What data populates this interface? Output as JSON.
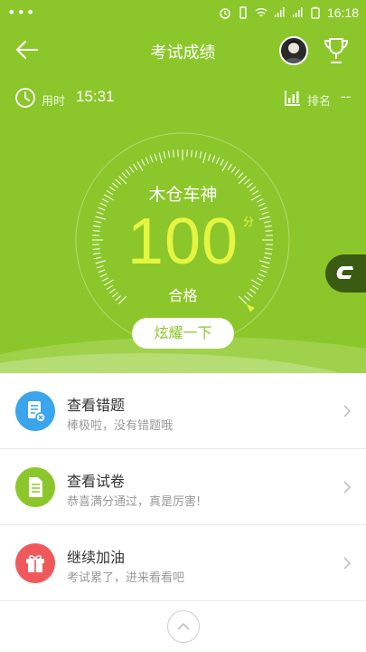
{
  "status_bar": {
    "dots": "•••",
    "time": "16:18"
  },
  "nav": {
    "title": "考试成绩",
    "back_icon": "arrow-left-icon",
    "trophy_icon": "trophy-icon"
  },
  "stats": {
    "time_label": "用时",
    "time_value": "15:31",
    "rank_label": "排名",
    "rank_value": "--"
  },
  "result": {
    "user_name": "木仓车神",
    "score": "100",
    "score_unit": "分",
    "status": "合格",
    "gauge_fraction": 1.0
  },
  "share_button": "炫耀一下",
  "menu": [
    {
      "title": "查看错题",
      "subtitle": "棒极啦，没有错题哦",
      "icon": "wrong-questions-icon",
      "color": "#3aa4ec"
    },
    {
      "title": "查看试卷",
      "subtitle": "恭喜满分通过，真是厉害!",
      "icon": "exam-paper-icon",
      "color": "#8bc72a"
    },
    {
      "title": "继续加油",
      "subtitle": "考试累了，进来看看吧",
      "icon": "gift-icon",
      "color": "#f0595b"
    }
  ],
  "colors": {
    "primary_green": "#8bc72a",
    "score_yellow": "#e4f542",
    "float_button": "#3b5a12"
  }
}
